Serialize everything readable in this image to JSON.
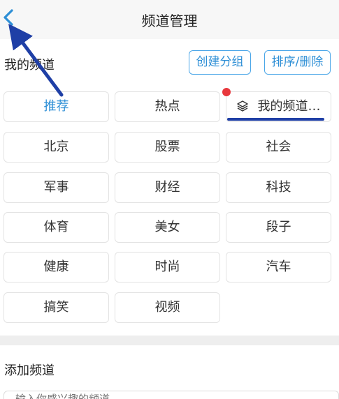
{
  "header": {
    "title": "频道管理",
    "back_icon": "chevron-left-icon"
  },
  "my_channels": {
    "label": "我的频道",
    "create_group_label": "创建分组",
    "sort_delete_label": "排序/删除",
    "items": [
      {
        "label": "推荐",
        "active": true
      },
      {
        "label": "热点"
      },
      {
        "label": "我的频道…",
        "icon": "layers-icon"
      },
      {
        "label": "北京"
      },
      {
        "label": "股票"
      },
      {
        "label": "社会"
      },
      {
        "label": "军事"
      },
      {
        "label": "财经"
      },
      {
        "label": "科技"
      },
      {
        "label": "体育"
      },
      {
        "label": "美女"
      },
      {
        "label": "段子"
      },
      {
        "label": "健康"
      },
      {
        "label": "时尚"
      },
      {
        "label": "汽车"
      },
      {
        "label": "搞笑"
      },
      {
        "label": "视频"
      }
    ]
  },
  "add_channels": {
    "label": "添加频道",
    "search_placeholder": "输入你感兴趣的频道"
  },
  "colors": {
    "accent": "#2e8fd6",
    "annotation": "#1f3fa6",
    "badge": "#e8383d"
  }
}
